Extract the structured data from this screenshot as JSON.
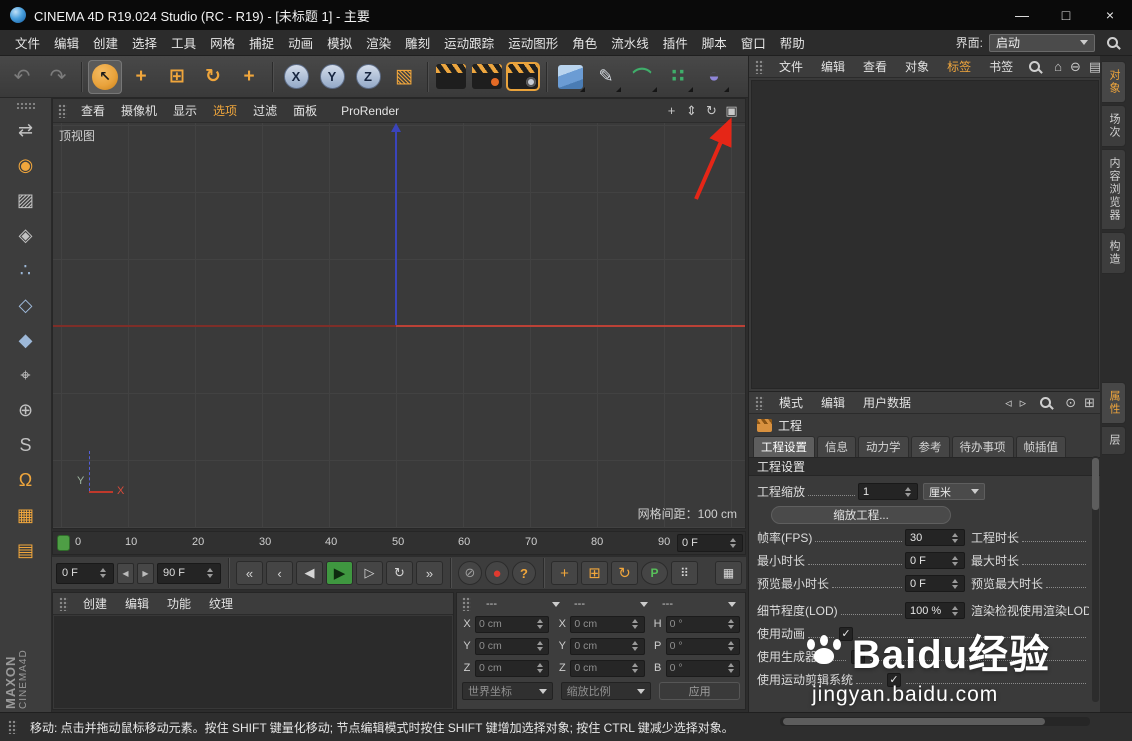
{
  "window": {
    "title": "CINEMA 4D R19.024 Studio (RC - R19) - [未标题 1] - 主要",
    "minimize": "—",
    "maximize": "□",
    "close": "×"
  },
  "menubar": {
    "items": [
      "文件",
      "编辑",
      "创建",
      "选择",
      "工具",
      "网格",
      "捕捉",
      "动画",
      "模拟",
      "渲染",
      "雕刻",
      "运动跟踪",
      "运动图形",
      "角色",
      "流水线",
      "插件",
      "脚本",
      "窗口",
      "帮助"
    ],
    "interface_label": "界面:",
    "interface_value": "启动"
  },
  "toolbar": {
    "undo": "↶",
    "redo": "↷",
    "select": "↖",
    "move": "+",
    "scale": "⊞",
    "rotate": "↻",
    "last_tool": "+",
    "axes": [
      "X",
      "Y",
      "Z"
    ],
    "coord": "▧",
    "pen": "✎",
    "sweep": "⌒",
    "mograph": "∷",
    "deformer": "◒"
  },
  "left_tools": [
    {
      "name": "make-editable",
      "glyph": "⇄"
    },
    {
      "name": "model-mode",
      "glyph": "◉"
    },
    {
      "name": "texture-mode",
      "glyph": "▨"
    },
    {
      "name": "workplane-mode",
      "glyph": "◈"
    },
    {
      "name": "points-mode",
      "glyph": "∴"
    },
    {
      "name": "edges-mode",
      "glyph": "◇"
    },
    {
      "name": "polygons-mode",
      "glyph": "◆"
    },
    {
      "name": "axis-mode",
      "glyph": "⌖"
    },
    {
      "name": "object-axis-mode",
      "glyph": "⊕"
    },
    {
      "name": "snap-mode",
      "glyph": "S"
    },
    {
      "name": "magnet-snap",
      "glyph": "Ω"
    },
    {
      "name": "workplane-snap",
      "glyph": "▦"
    },
    {
      "name": "quantize-snap",
      "glyph": "▤"
    }
  ],
  "viewport": {
    "menu": [
      "查看",
      "摄像机",
      "显示",
      "选项",
      "过滤",
      "面板",
      "ProRender"
    ],
    "view_label": "顶视图",
    "grid_spacing": "网格间距：100 cm",
    "gizmo_y": "Y",
    "gizmo_x": "X",
    "nav_icons": [
      "+",
      "⇕",
      "↻",
      "▣"
    ]
  },
  "timeline": {
    "ticks": [
      "0",
      "10",
      "20",
      "30",
      "40",
      "50",
      "60",
      "70",
      "80",
      "90"
    ],
    "frame_field": "0 F"
  },
  "transport": {
    "current_frame": "0 F",
    "prev": "◀",
    "next": "▶",
    "end_frame": "90 F",
    "buttons": [
      "«",
      "‹",
      "◀",
      "▶",
      "▷",
      "↻",
      "»"
    ],
    "record": [
      "⊘",
      "●",
      "?"
    ],
    "tools": [
      "+",
      "⊞",
      "↻",
      "P",
      "⠿",
      "▦"
    ]
  },
  "materials": {
    "menu": [
      "创建",
      "编辑",
      "功能",
      "纹理"
    ]
  },
  "coordinates": {
    "headers": [
      "---",
      "---",
      "---"
    ],
    "position": {
      "labels": [
        "X",
        "Y",
        "Z"
      ],
      "values": [
        "0 cm",
        "0 cm",
        "0 cm"
      ]
    },
    "size": {
      "labels": [
        "X",
        "Y",
        "Z"
      ],
      "values": [
        "0 cm",
        "0 cm",
        "0 cm"
      ]
    },
    "rotation": {
      "labels": [
        "H",
        "P",
        "B"
      ],
      "values": [
        "0 °",
        "0 °",
        "0 °"
      ]
    },
    "system": "世界坐标",
    "mode": "缩放比例",
    "apply": "应用"
  },
  "object_manager": {
    "menu": [
      "文件",
      "编辑",
      "查看",
      "对象",
      "标签",
      "书签"
    ],
    "icons": [
      "⌂",
      "⊖",
      "▤"
    ]
  },
  "attributes": {
    "menu": [
      "模式",
      "编辑",
      "用户数据"
    ],
    "icons": [
      "◃",
      "▹",
      "⊙",
      "⊞"
    ],
    "object_label": "工程",
    "tabs": [
      "工程设置",
      "信息",
      "动力学",
      "参考",
      "待办事项",
      "帧插值"
    ],
    "section_title": "工程设置",
    "rows": {
      "scale_label": "工程缩放",
      "scale_value": "1",
      "scale_unit": "厘米",
      "scale_button": "缩放工程...",
      "fps_label": "帧率(FPS)",
      "fps_value": "30",
      "length_label": "工程时长",
      "min_label": "最小时长",
      "min_value": "0 F",
      "max_label": "最大时长",
      "preview_min_label": "预览最小时长",
      "preview_min_value": "0 F",
      "preview_max_label": "预览最大时长",
      "lod_label": "细节程度(LOD)",
      "lod_value": "100 %",
      "lod_right_label": "渲染检视使用渲染LOD",
      "use_animation_label": "使用动画",
      "use_generators_label": "使用生成器",
      "use_motion_clip_label": "使用运动剪辑系统",
      "check": "✓"
    }
  },
  "side_tabs": {
    "top": [
      "对象",
      "场次",
      "内容浏览器",
      "构造"
    ],
    "middle": [
      "属性",
      "层"
    ]
  },
  "watermark": {
    "line1": "Baidu经验",
    "line2": "jingyan.baidu.com"
  },
  "branding": {
    "line1": "MAXON",
    "line2": "CINEMA4D"
  },
  "statusbar": {
    "text": "移动: 点击并拖动鼠标移动元素。按住 SHIFT 键量化移动; 节点编辑模式时按住 SHIFT 键增加选择对象; 按住 CTRL 键减少选择对象。"
  }
}
